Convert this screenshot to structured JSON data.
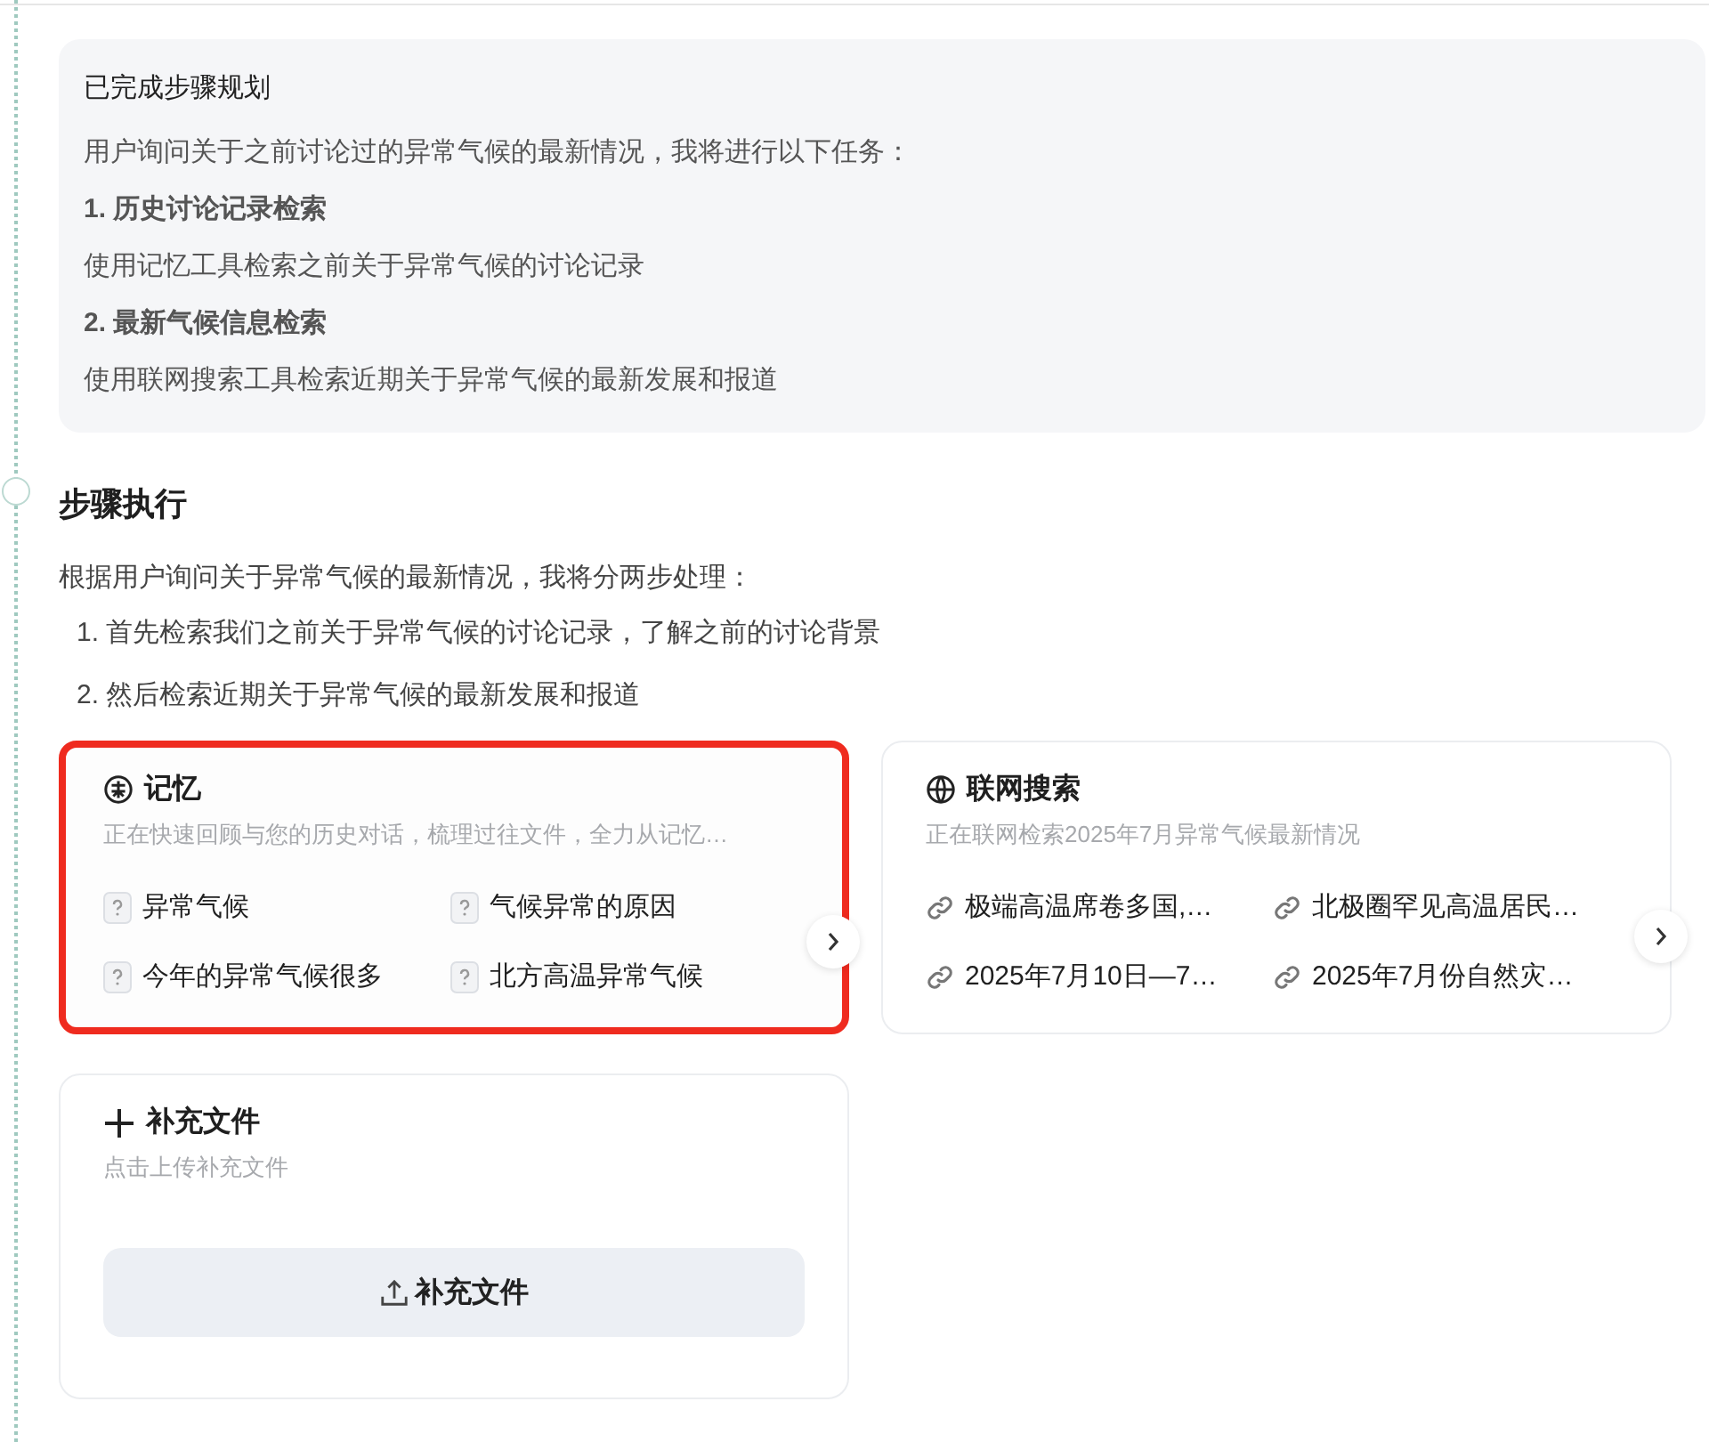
{
  "plan": {
    "title": "已完成步骤规划",
    "lines": [
      {
        "kind": "text",
        "text": "用户询问关于之前讨论过的异常气候的最新情况，我将进行以下任务："
      },
      {
        "kind": "step",
        "text": "1. 历史讨论记录检索"
      },
      {
        "kind": "text",
        "text": "使用记忆工具检索之前关于异常气候的讨论记录"
      },
      {
        "kind": "step",
        "text": "2. 最新气候信息检索"
      },
      {
        "kind": "text",
        "text": "使用联网搜索工具检索近期关于异常气候的最新发展和报道"
      }
    ]
  },
  "execution": {
    "heading": "步骤执行",
    "intro": "根据用户询问关于异常气候的最新情况，我将分两步处理：",
    "steps": [
      "1. 首先检索我们之前关于异常气候的讨论记录，了解之前的讨论背景",
      "2. 然后检索近期关于异常气候的最新发展和报道"
    ]
  },
  "tools": [
    {
      "kind": "memory",
      "title": "记忆",
      "subtitle": "正在快速回顾与您的历史对话，梳理过往文件，全力从记忆…",
      "highlighted": true,
      "items": [
        "异常气候",
        "气候异常的原因",
        "今年的异常气候很多",
        "北方高温异常气候"
      ]
    },
    {
      "kind": "web",
      "title": "联网搜索",
      "subtitle": "正在联网检索2025年7月异常气候最新情况",
      "highlighted": false,
      "items": [
        "极端高温席卷多国,…",
        "北极圈罕见高温居民…",
        "2025年7月10日—7…",
        "2025年7月份自然灾…"
      ]
    }
  ],
  "upload": {
    "title": "补充文件",
    "subtitle": "点击上传补充文件",
    "button": "补充文件"
  }
}
